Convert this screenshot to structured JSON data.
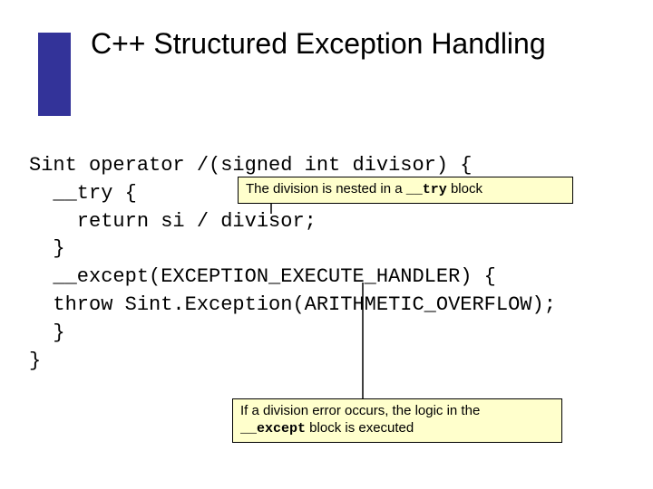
{
  "title": "C++ Structured Exception Handling",
  "code": {
    "l1": "Sint operator /(signed int divisor) {",
    "l2": "  __try {",
    "l3": "    return si / divisor;",
    "l4": "  }",
    "l5": "  __except(EXCEPTION_EXECUTE_HANDLER) {",
    "l6": "  throw Sint.Exception(ARITHMETIC_OVERFLOW);",
    "l7": "  }",
    "l8": "}"
  },
  "callouts": {
    "top_prefix": "The division is nested in a ",
    "top_mono": "__try",
    "top_suffix": " block",
    "bottom_line1": "If a division error occurs, the logic in the",
    "bottom_mono": "__except",
    "bottom_line2_suffix": " block is executed"
  }
}
